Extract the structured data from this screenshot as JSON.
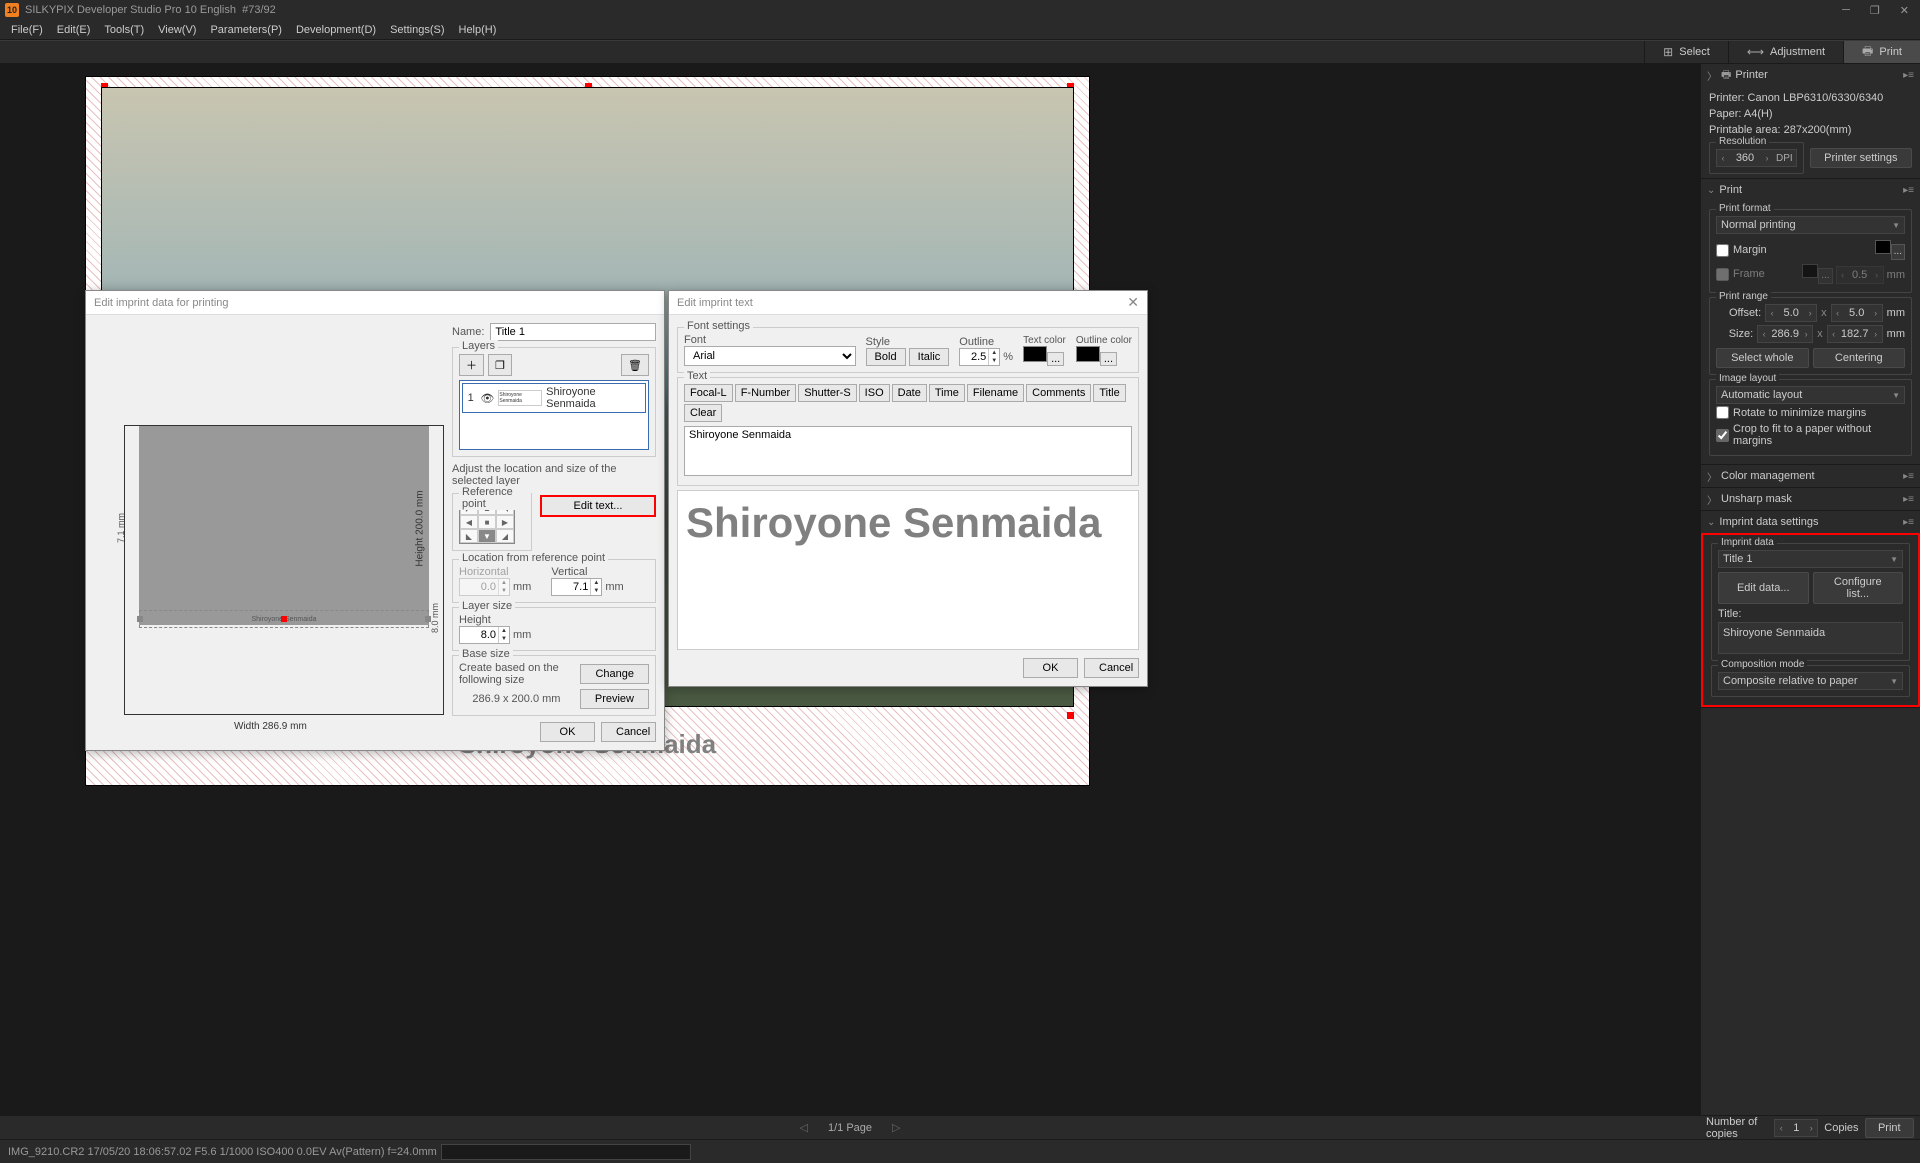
{
  "titlebar": {
    "app": "SILKYPIX Developer Studio Pro 10 English",
    "doc": "#73/92"
  },
  "menu": [
    "File(F)",
    "Edit(E)",
    "Tools(T)",
    "View(V)",
    "Parameters(P)",
    "Development(D)",
    "Settings(S)",
    "Help(H)"
  ],
  "toolbar": {
    "select": "Select",
    "adjustment": "Adjustment",
    "print": "Print"
  },
  "panels": {
    "printer": {
      "title": "Printer",
      "device": "Printer: Canon LBP6310/6330/6340",
      "paper": "Paper: A4(H)",
      "area": "Printable area: 287x200(mm)",
      "res_label": "Resolution",
      "res_value": "360",
      "res_unit": "DPI",
      "settings_btn": "Printer settings"
    },
    "print": {
      "title": "Print",
      "format_label": "Print format",
      "format_value": "Normal printing",
      "margin": "Margin",
      "frame": "Frame",
      "frame_val": "0.5",
      "frame_unit": "mm",
      "range_label": "Print range",
      "offset_label": "Offset:",
      "offset_x": "5.0",
      "offset_y": "5.0",
      "offset_unit": "mm",
      "size_label": "Size:",
      "size_w": "286.9",
      "size_h": "182.7",
      "size_unit": "mm",
      "select_whole": "Select whole",
      "centering": "Centering",
      "layout_label": "Image layout",
      "layout_value": "Automatic layout",
      "rotate": "Rotate to minimize margins",
      "crop": "Crop to fit to a paper without margins"
    },
    "color_mgmt": "Color management",
    "unsharp": "Unsharp mask",
    "imprint_settings": {
      "title": "Imprint data settings",
      "data_label": "Imprint data",
      "data_value": "Title 1",
      "edit_btn": "Edit data...",
      "config_btn": "Configure list...",
      "title_label": "Title:",
      "title_value": "Shiroyone Senmaida",
      "comp_label": "Composition mode",
      "comp_value": "Composite relative to paper"
    }
  },
  "preview": {
    "imprint_text": "Shiroyone Senmaida"
  },
  "dialog1": {
    "title": "Edit imprint data for printing",
    "name_label": "Name:",
    "name_value": "Title 1",
    "layers_label": "Layers",
    "layer_num": "1",
    "layer_text": "Shiroyone Senmaida",
    "layer_thumb": "Shiroyone Senmaida",
    "adjust_label": "Adjust the location and size of the selected layer",
    "refpt_label": "Reference point",
    "edit_text_btn": "Edit text...",
    "loc_label": "Location from reference point",
    "horiz_label": "Horizontal",
    "horiz_val": "0.0",
    "horiz_unit": "mm",
    "vert_label": "Vertical",
    "vert_val": "7.1",
    "vert_unit": "mm",
    "layer_size_label": "Layer size",
    "height_label": "Height",
    "height_val": "8.0",
    "height_unit": "mm",
    "base_size_label": "Base size",
    "base_desc": "Create based on the following size",
    "change_btn": "Change",
    "size_display": "286.9 x 200.0 mm",
    "preview_btn": "Preview",
    "ok": "OK",
    "cancel": "Cancel",
    "ruler_width": "Width 286.9 mm",
    "ruler_height": "Height 200.0 mm",
    "ruler_margin": "7.1 mm",
    "ruler_h": "8.0 mm"
  },
  "dialog2": {
    "title": "Edit imprint text",
    "font_settings": "Font settings",
    "font_label": "Font",
    "font_value": "Arial",
    "style_label": "Style",
    "bold": "Bold",
    "italic": "Italic",
    "outline_label": "Outline",
    "outline_val": "2.5",
    "outline_unit": "%",
    "text_color": "Text color",
    "outline_color": "Outline color",
    "text_label": "Text",
    "tokens": [
      "Focal-L",
      "F-Number",
      "Shutter-S",
      "ISO",
      "Date",
      "Time",
      "Filename",
      "Comments",
      "Title",
      "Clear"
    ],
    "text_value": "Shiroyone Senmaida",
    "preview_text": "Shiroyone Senmaida",
    "ok": "OK",
    "cancel": "Cancel"
  },
  "pager": {
    "page": "1/1 Page"
  },
  "copies": {
    "label": "Number of copies",
    "value": "1",
    "unit": "Copies",
    "print_btn": "Print"
  },
  "status": "IMG_9210.CR2 17/05/20 18:06:57.02 F5.6 1/1000 ISO400  0.0EV Av(Pattern) f=24.0mm"
}
